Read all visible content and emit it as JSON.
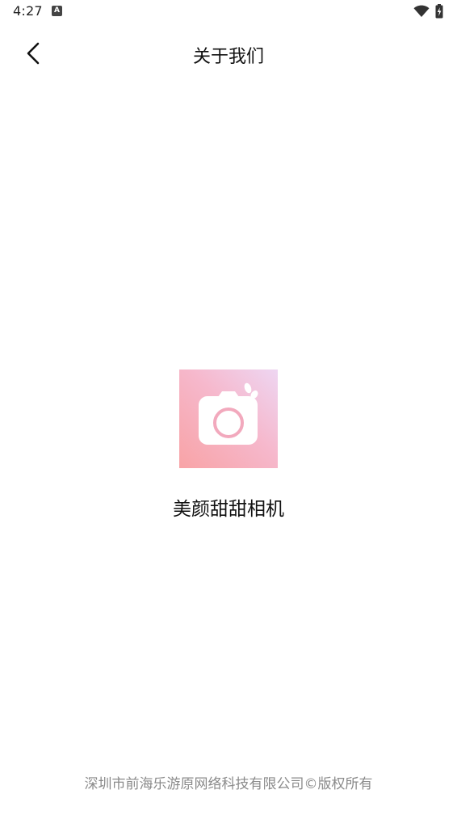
{
  "status_bar": {
    "time": "4:27",
    "notification_icon": "A",
    "icons": [
      "wifi-icon",
      "battery-charging-icon"
    ]
  },
  "header": {
    "back_icon": "chevron-left-icon",
    "title": "关于我们"
  },
  "app": {
    "logo_icon": "camera-icon",
    "name": "美颜甜甜相机"
  },
  "footer": {
    "copyright": "深圳市前海乐游原网络科技有限公司©版权所有"
  },
  "colors": {
    "logo_gradient_start": "#eed6f2",
    "logo_gradient_mid": "#f6b8cc",
    "logo_gradient_end": "#f8a3a6",
    "camera_lens_ring": "#f2a9bd",
    "footer_text": "#8a8a8a"
  }
}
